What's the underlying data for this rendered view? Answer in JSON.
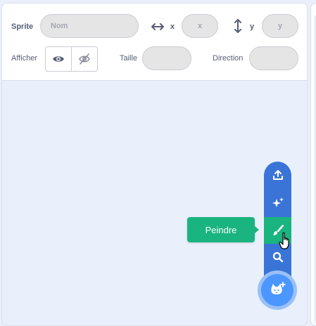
{
  "sprite_info": {
    "sprite_label": "Sprite",
    "name_placeholder": "Nom",
    "x_label": "x",
    "x_placeholder": "x",
    "y_label": "y",
    "y_placeholder": "y",
    "show_label": "Afficher",
    "size_label": "Taille",
    "direction_label": "Direction"
  },
  "sprite_menu": {
    "items": [
      {
        "name": "upload-sprite",
        "icon": "upload-icon"
      },
      {
        "name": "surprise",
        "icon": "sparkle-icon"
      },
      {
        "name": "paint",
        "icon": "paintbrush-icon",
        "active": true
      },
      {
        "name": "search",
        "icon": "search-icon"
      }
    ],
    "tooltip": "Peindre",
    "main_icon": "cat-plus-icon"
  },
  "colors": {
    "menu_blue": "#3a74d7",
    "active_green": "#19b47f",
    "main_button": "#4c97ff",
    "label_text": "#575e75"
  }
}
